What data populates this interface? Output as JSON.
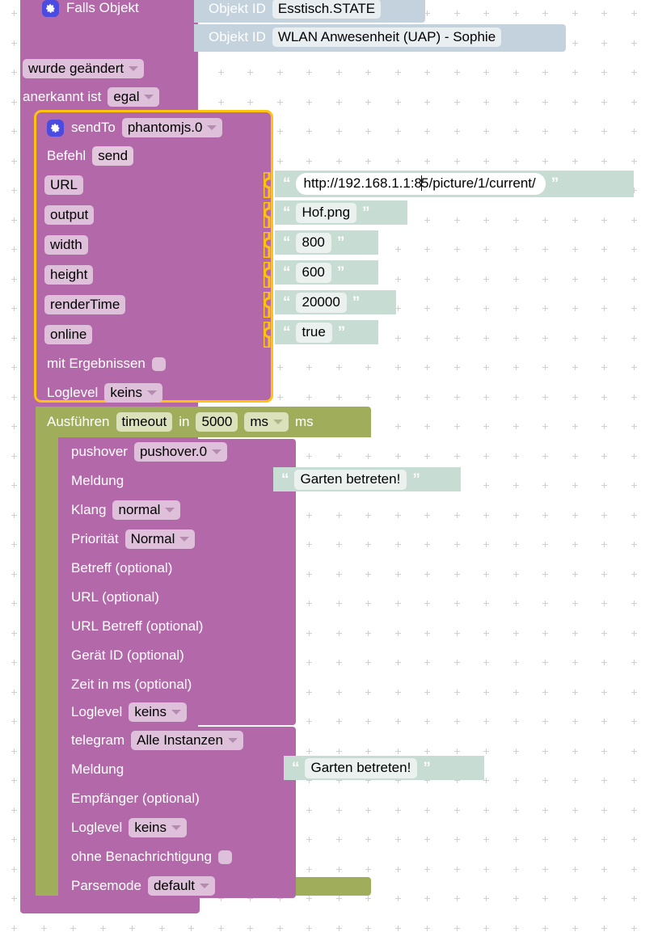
{
  "workspace": {
    "background": "#ffffff",
    "grid_dot_color": "#cfcfcf"
  },
  "colors": {
    "control_block": "#b368aa",
    "timeout_block": "#a0ae5b",
    "string_block": "#c7dcd2",
    "object_id_block": "#c3d2dd",
    "selection_outline": "#ffc20e",
    "gear_icon": "#4b4bdf",
    "field_chip": "#dfc0da"
  },
  "if_object_block": {
    "gear_icon": "gear-icon",
    "title": "Falls Objekt",
    "object_id_rows": [
      {
        "label": "Objekt ID",
        "value": "Esstisch.STATE"
      },
      {
        "label": "Objekt ID",
        "value": "WLAN Anwesenheit (UAP) - Sophie"
      }
    ],
    "trigger_dropdown": "wurde geändert",
    "ack_label": "anerkannt ist",
    "ack_dropdown": "egal"
  },
  "sendto_block": {
    "selected": true,
    "gear_icon": "gear-icon",
    "title": "sendTo",
    "instance_dropdown": "phantomjs.0",
    "command_label": "Befehl",
    "command_value": "send",
    "fields": [
      {
        "name": "URL",
        "value": "http://192.168.1.1:85/picture/1/current/",
        "editing": true
      },
      {
        "name": "output",
        "value": "Hof.png",
        "editing": false
      },
      {
        "name": "width",
        "value": "800",
        "editing": false
      },
      {
        "name": "height",
        "value": "600",
        "editing": false
      },
      {
        "name": "renderTime",
        "value": "20000",
        "editing": false
      },
      {
        "name": "online",
        "value": "true",
        "editing": false
      }
    ],
    "with_results_label": "mit Ergebnissen",
    "with_results_checked": false,
    "loglevel_label": "Loglevel",
    "loglevel_value": "keins"
  },
  "timeout_block": {
    "prefix": "Ausführen",
    "name_value": "timeout",
    "in_label": "in",
    "duration": "5000",
    "unit_dropdown": "ms",
    "unit_suffix": "ms"
  },
  "pushover_block": {
    "title": "pushover",
    "instance_dropdown": "pushover.0",
    "message_label": "Meldung",
    "message_value": "Garten betreten!",
    "sound_label": "Klang",
    "sound_value": "normal",
    "priority_label": "Priorität",
    "priority_value": "Normal",
    "optional_rows": [
      "Betreff (optional)",
      "URL (optional)",
      "URL Betreff (optional)",
      "Gerät ID (optional)",
      "Zeit in ms (optional)"
    ],
    "loglevel_label": "Loglevel",
    "loglevel_value": "keins"
  },
  "telegram_block": {
    "title": "telegram",
    "instance_dropdown": "Alle Instanzen",
    "message_label": "Meldung",
    "message_value": "Garten betreten!",
    "recipient_label": "Empfänger (optional)",
    "loglevel_label": "Loglevel",
    "loglevel_value": "keins",
    "silent_label": "ohne Benachrichtigung",
    "silent_checked": false,
    "parsemode_label": "Parsemode",
    "parsemode_value": "default"
  }
}
